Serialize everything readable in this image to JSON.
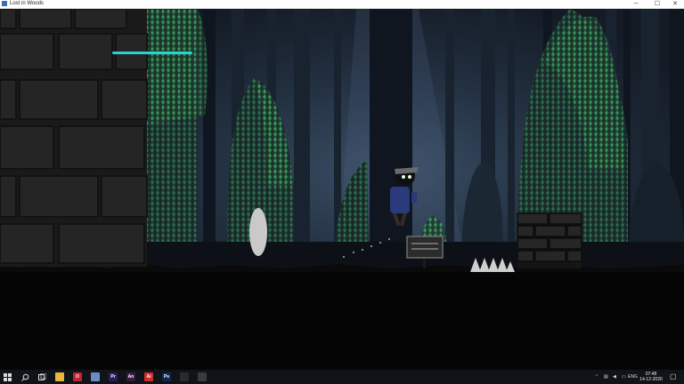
{
  "window": {
    "title": "Lost in Woods",
    "minimize_glyph": "─",
    "maximize_glyph": "☐",
    "close_glyph": "✕"
  },
  "game": {
    "health_bar_fill": 1.0,
    "colors": {
      "health": "#2bd3d0",
      "sky": "#1d2836",
      "ground": "#050505",
      "foliage": "#37a95a",
      "wall": "#1c1c1c",
      "egg": "#c9c9c9"
    }
  },
  "taskbar": {
    "start_icon": "windows-logo-icon",
    "search_icon": "search-icon",
    "task_view_icon": "task-view-icon",
    "apps": [
      {
        "name": "file-explorer-icon",
        "text": "",
        "color": "#e8b73c"
      },
      {
        "name": "opera-icon",
        "text": "O",
        "color": "#c3232f"
      },
      {
        "name": "notepad-icon",
        "text": "",
        "color": "#6a8cc7"
      },
      {
        "name": "premiere-icon",
        "text": "Pr",
        "color": "#2a1a5e"
      },
      {
        "name": "animate-icon",
        "text": "An",
        "color": "#3b1a42"
      },
      {
        "name": "illustrator-icon",
        "text": "Ai",
        "color": "#d12d2d"
      },
      {
        "name": "photoshop-icon",
        "text": "Ps",
        "color": "#0d2a4e"
      },
      {
        "name": "unity-icon",
        "text": "",
        "color": "#2a2a2a"
      },
      {
        "name": "game-icon",
        "text": "",
        "color": "#3a3a3a"
      }
    ],
    "tray": {
      "language": "ENG",
      "time": "07:48",
      "date": "14-12-2020"
    }
  }
}
